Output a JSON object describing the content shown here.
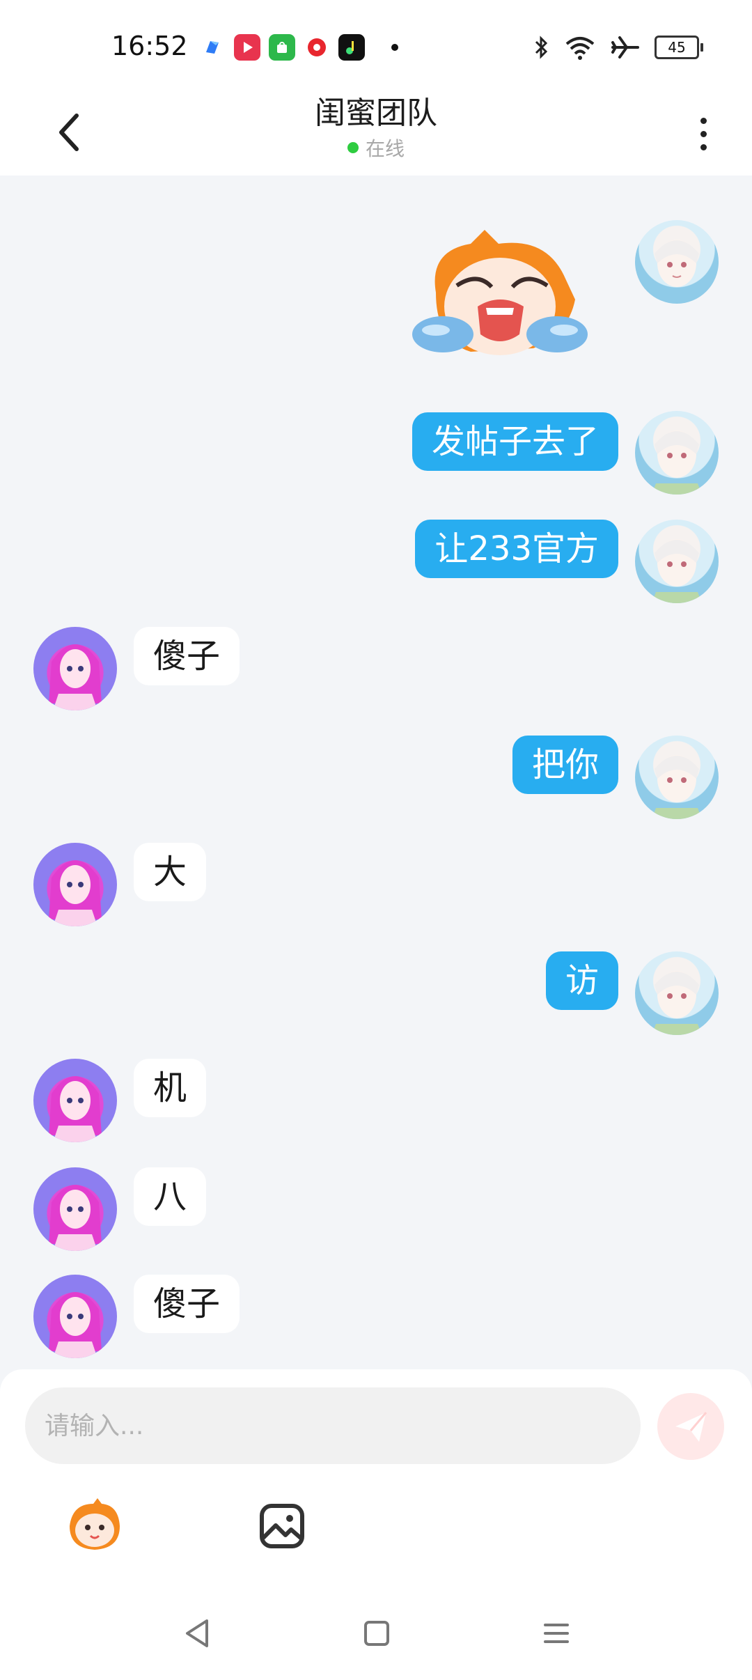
{
  "status_bar": {
    "time": "16:52",
    "battery": "45",
    "notification_icons": [
      "blue-app-icon",
      "video-app-icon",
      "green-shop-icon",
      "red-record-icon",
      "music-app-icon"
    ],
    "system_icons": [
      "bluetooth-icon",
      "wifi-icon",
      "airplane-icon",
      "battery-icon"
    ]
  },
  "header": {
    "title": "闺蜜团队",
    "status": "在线"
  },
  "messages": [
    {
      "sender": "me",
      "type": "sticker",
      "sticker": "crying-mascot-sticker"
    },
    {
      "sender": "me",
      "type": "text",
      "text": "发帖子去了"
    },
    {
      "sender": "me",
      "type": "text",
      "text": "让233官方"
    },
    {
      "sender": "other",
      "type": "text",
      "text": "傻子"
    },
    {
      "sender": "me",
      "type": "text",
      "text": "把你"
    },
    {
      "sender": "other",
      "type": "text",
      "text": "大"
    },
    {
      "sender": "me",
      "type": "text",
      "text": "访"
    },
    {
      "sender": "other",
      "type": "text",
      "text": "机"
    },
    {
      "sender": "other",
      "type": "text",
      "text": "八"
    },
    {
      "sender": "other",
      "type": "text",
      "text": "傻子"
    }
  ],
  "composer": {
    "placeholder": "请输入...",
    "value": ""
  },
  "colors": {
    "my_bubble": "#28adf0",
    "their_bubble": "#ffffff",
    "background": "#f3f5f8",
    "online_dot": "#2ecc40",
    "send_button": "#ffe8e8"
  }
}
